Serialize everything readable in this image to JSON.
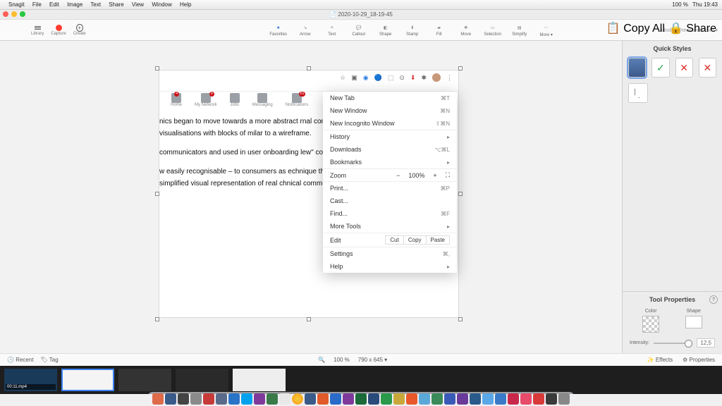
{
  "mac": {
    "menu": [
      "Snagit",
      "File",
      "Edit",
      "Image",
      "Text",
      "Share",
      "View",
      "Window",
      "Help"
    ],
    "status": [
      "S",
      "⌘",
      "⎋",
      "⬡",
      "⚙",
      "♡",
      "⚡",
      "⏏",
      "📶",
      "🕒",
      "100 %",
      "⚡",
      "Thu 19:43",
      "🔍",
      "⦿",
      "≡"
    ]
  },
  "snagit": {
    "title": "2020-10-29_18-19-45",
    "account": "a.boilen@techsmith.com ▾",
    "left": {
      "library": "Library",
      "capture": "Capture",
      "create": "Create"
    },
    "tools": [
      "Favorites",
      "Arrow",
      "Text",
      "Callout",
      "Shape",
      "Stamp",
      "Fill",
      "Move",
      "Selection",
      "Simplify"
    ],
    "more": "More ▾",
    "copyAll": "Copy All",
    "share": "Share"
  },
  "linkedin": {
    "nav": [
      {
        "label": "Home",
        "badge": "4"
      },
      {
        "label": "My Network",
        "badge": "9"
      },
      {
        "label": "Jobs",
        "badge": ""
      },
      {
        "label": "Messaging",
        "badge": ""
      },
      {
        "label": "Notifications",
        "badge": "61"
      }
    ],
    "paras": [
      "nics began to move towards a more abstract rnal communications, especially among y simple visualisations with blocks of milar to a wireframe.",
      "communicators and used in user onboarding lew\" content, making its way into classic",
      "w easily recognisable – to consumers as echnique that a lot of companies are using, ut, simplified visual representation of real chnical communication circles it came to be"
    ]
  },
  "menu": {
    "newTab": {
      "l": "New Tab",
      "s": "⌘T"
    },
    "newWindow": {
      "l": "New Window",
      "s": "⌘N"
    },
    "incognito": {
      "l": "New Incognito Window",
      "s": "⇧⌘N"
    },
    "history": {
      "l": "History",
      "s": "▸"
    },
    "downloads": {
      "l": "Downloads",
      "s": "⌥⌘L"
    },
    "bookmarks": {
      "l": "Bookmarks",
      "s": "▸"
    },
    "zoom": {
      "l": "Zoom",
      "val": "100%",
      "minus": "−",
      "plus": "+",
      "full": "⛶"
    },
    "print": {
      "l": "Print...",
      "s": "⌘P"
    },
    "cast": {
      "l": "Cast..."
    },
    "find": {
      "l": "Find...",
      "s": "⌘F"
    },
    "moreTools": {
      "l": "More Tools",
      "s": "▸"
    },
    "edit": {
      "l": "Edit",
      "cut": "Cut",
      "copy": "Copy",
      "paste": "Paste"
    },
    "settings": {
      "l": "Settings",
      "s": "⌘,"
    },
    "help": {
      "l": "Help",
      "s": "▸"
    }
  },
  "quickStyles": {
    "title": "Quick Styles",
    "checks": [
      "✓",
      "✕",
      "✕"
    ]
  },
  "toolProps": {
    "title": "Tool Properties",
    "color": "Color",
    "shape": "Shape",
    "intensity": "Intensity:",
    "intensityVal": "12,5"
  },
  "footer": {
    "recent": "Recent",
    "tag": "Tag",
    "zoom": "100 %",
    "dims": "790 x 645 ▾",
    "effects": "Effects",
    "properties": "Properties"
  },
  "tray": {
    "thumb1": "00:11.mp4"
  }
}
